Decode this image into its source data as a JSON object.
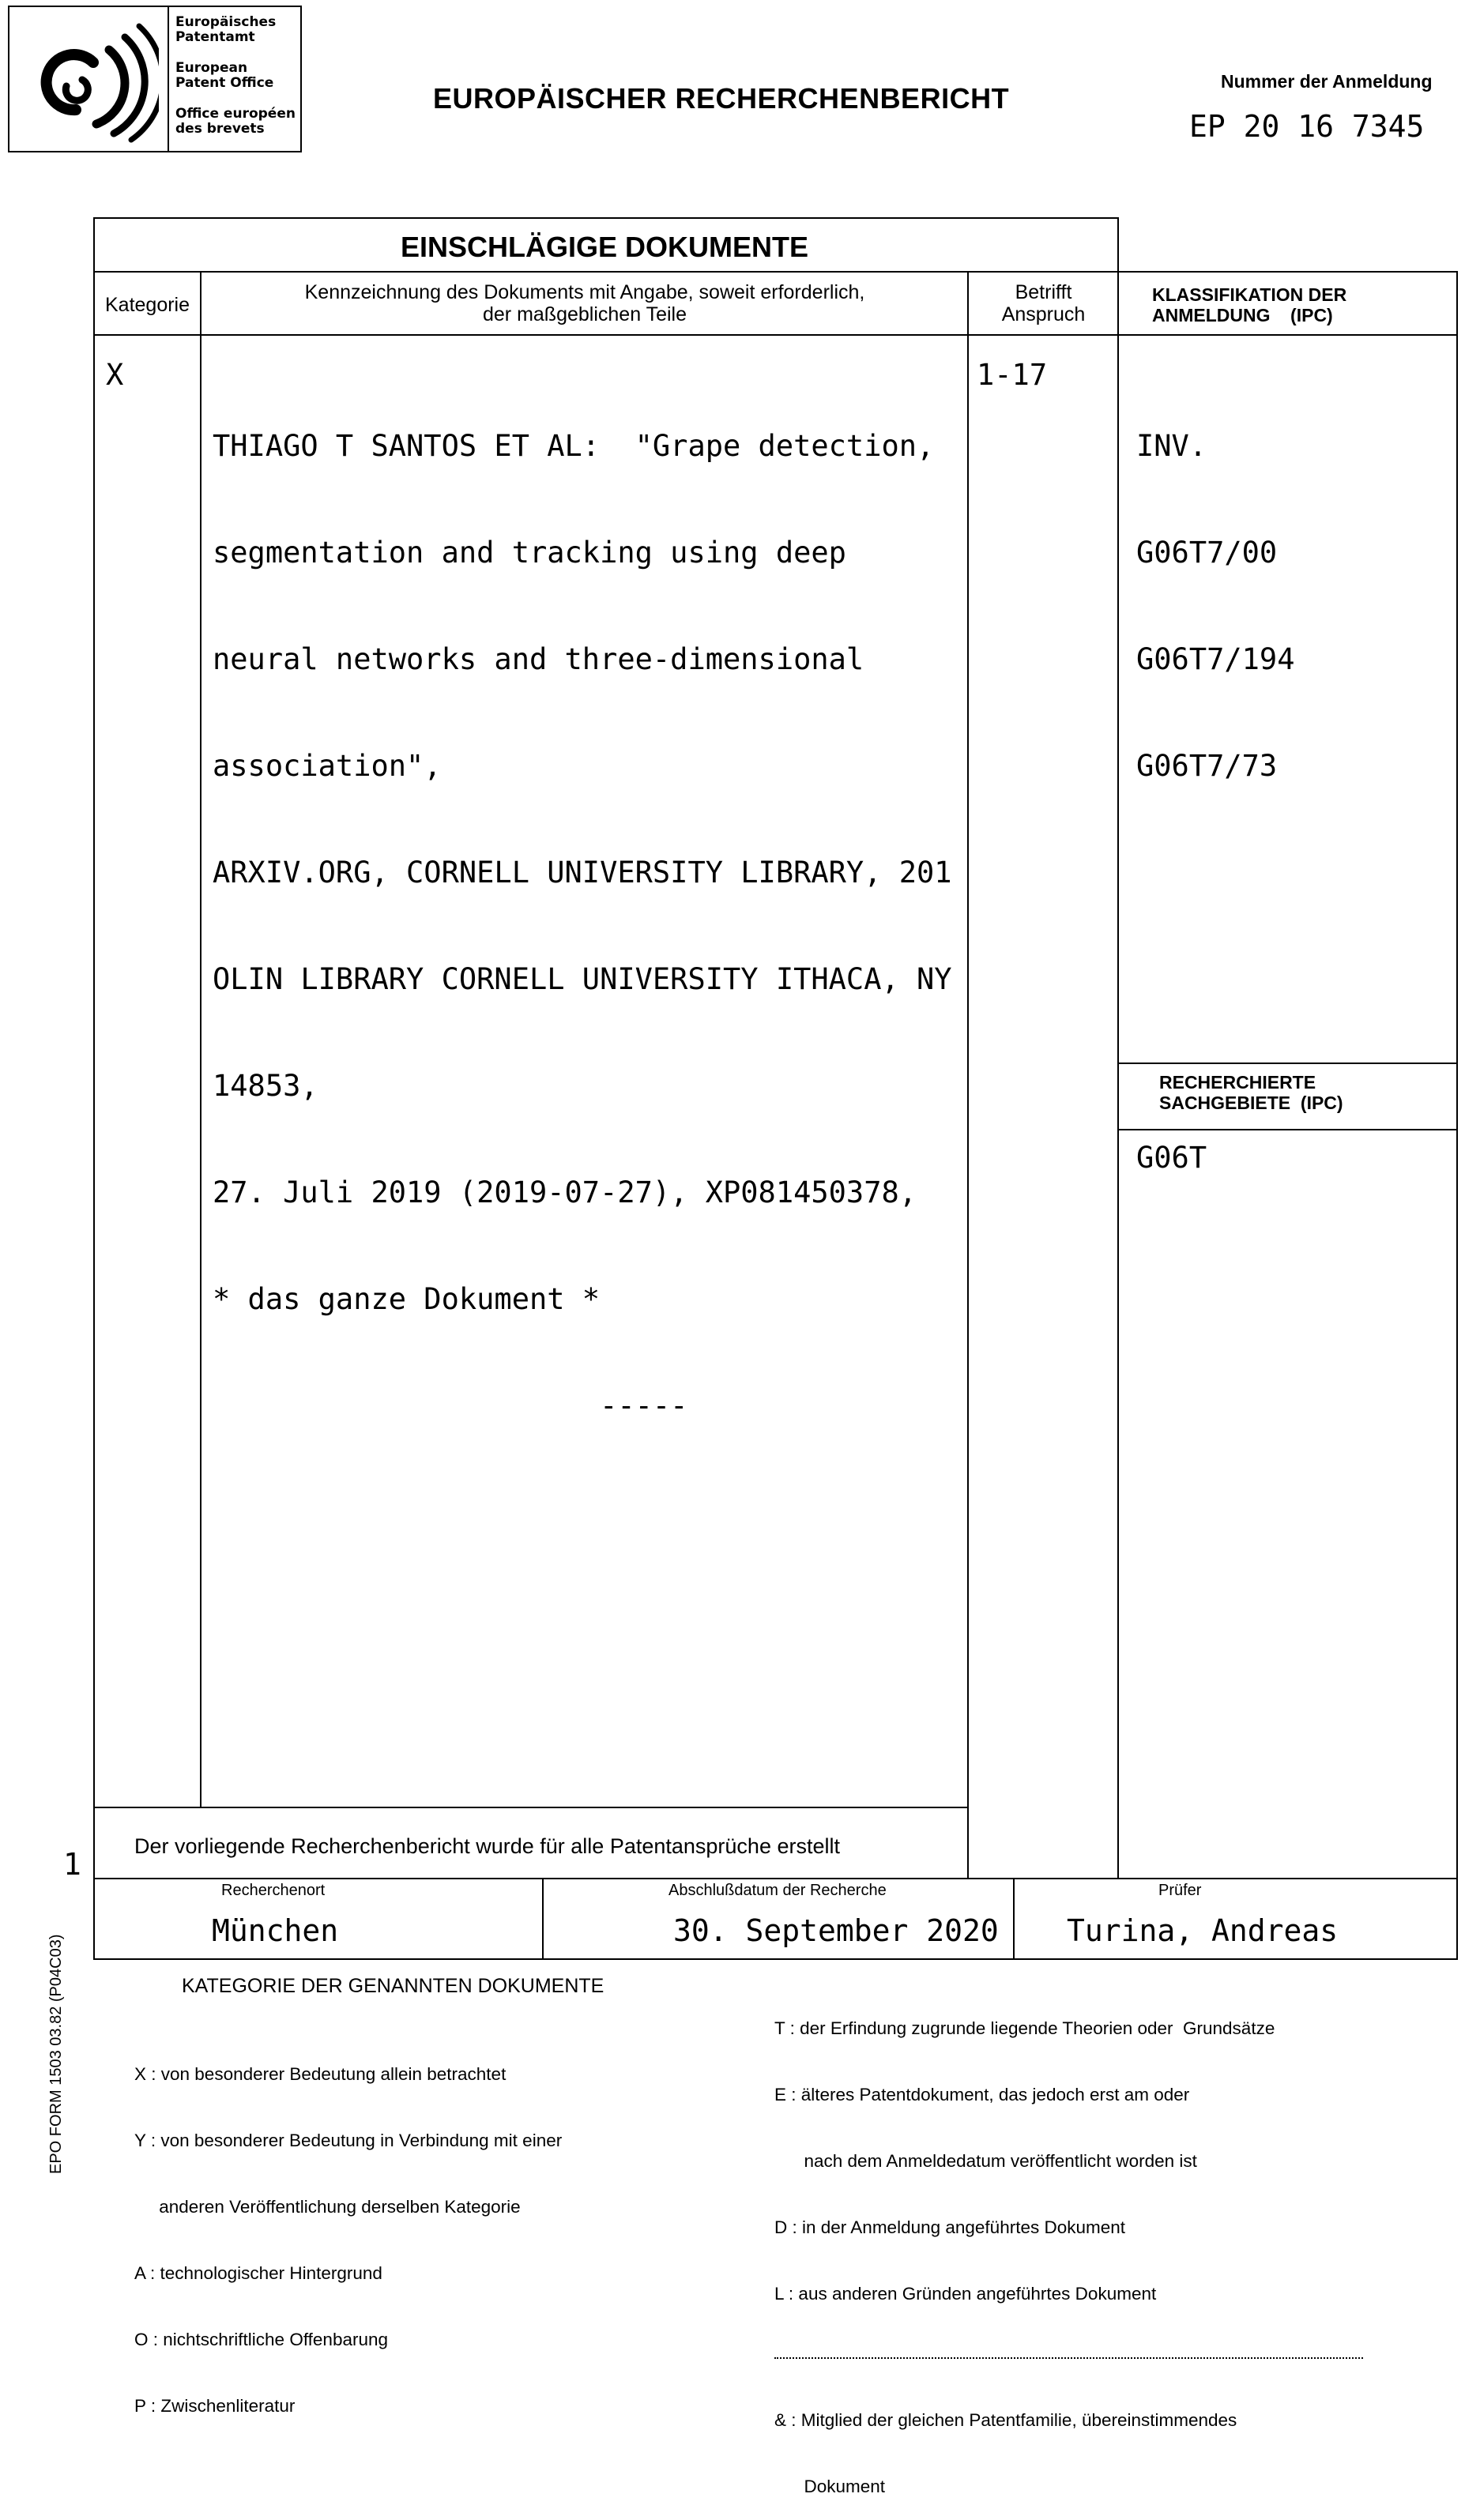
{
  "logo": {
    "lines": [
      "Europäisches",
      "Patentamt",
      "European",
      "Patent Office",
      "Office européen",
      "des brevets"
    ]
  },
  "header": {
    "title": "EUROPÄISCHER RECHERCHENBERICHT",
    "application_number_label": "Nummer der Anmeldung",
    "application_number": "EP 20 16 7345"
  },
  "table": {
    "section_title": "EINSCHLÄGIGE DOKUMENTE",
    "col_category": "Kategorie",
    "col_citation_line1": "Kennzeichnung des Dokuments mit Angabe, soweit erforderlich,",
    "col_citation_line2": "der maßgeblichen Teile",
    "col_claim_line1": "Betrifft",
    "col_claim_line2": "Anspruch",
    "col_class_line1": "KLASSIFIKATION DER",
    "col_class_line2": "ANMELDUNG    (IPC)",
    "row": {
      "category": "X",
      "citation": [
        "THIAGO T SANTOS ET AL:  \"Grape detection,",
        "segmentation and tracking using deep",
        "neural networks and three-dimensional",
        "association\",",
        "ARXIV.ORG, CORNELL UNIVERSITY LIBRARY, 201",
        "OLIN LIBRARY CORNELL UNIVERSITY ITHACA, NY",
        "14853,",
        "27. Juli 2019 (2019-07-27), XP081450378,",
        "* das ganze Dokument *",
        "                      -----"
      ],
      "claims": "1-17",
      "classification": [
        "INV.",
        "G06T7/00",
        "G06T7/194",
        "G06T7/73"
      ]
    },
    "searched_fields_label_line1": "RECHERCHIERTE",
    "searched_fields_label_line2": "SACHGEBIETE  (IPC)",
    "searched_fields": "G06T",
    "statement": "Der vorliegende Recherchenbericht wurde für alle Patentansprüche erstellt"
  },
  "footer": {
    "place_label": "Recherchenort",
    "place": "München",
    "date_label": "Abschlußdatum der Recherche",
    "date": "30. September 2020",
    "examiner_label": "Prüfer",
    "examiner": "Turina, Andreas",
    "page_marker": "1",
    "form_code": "EPO FORM 1503 03.82 (P04C03)"
  },
  "categories": {
    "title": "KATEGORIE DER GENANNTEN DOKUMENTE",
    "left": [
      "X : von besonderer Bedeutung allein betrachtet",
      "Y : von besonderer Bedeutung in Verbindung mit einer",
      "     anderen Veröffentlichung derselben Kategorie",
      "A : technologischer Hintergrund",
      "O : nichtschriftliche Offenbarung",
      "P : Zwischenliteratur"
    ],
    "right": [
      "T : der Erfindung zugrunde liegende Theorien oder  Grundsätze",
      "E : älteres Patentdokument, das jedoch erst am oder",
      "      nach dem Anmeldedatum veröffentlicht worden ist",
      "D : in der Anmeldung angeführtes Dokument",
      "L : aus anderen Gründen angeführtes Dokument",
      "& : Mitglied der gleichen Patentfamilie, übereinstimmendes",
      "      Dokument"
    ]
  }
}
